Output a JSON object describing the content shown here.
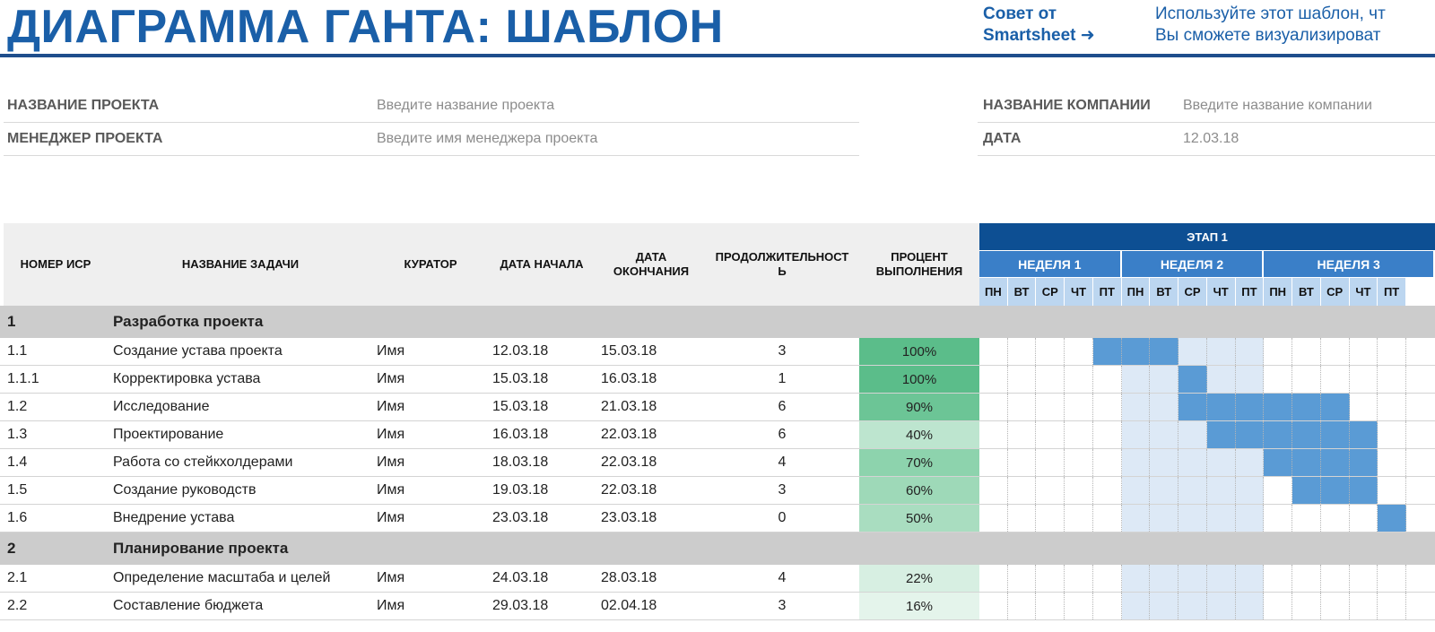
{
  "header": {
    "title": "ДИАГРАММА ГАНТА: ШАБЛОН",
    "tip_label_line1": "Совет от",
    "tip_label_line2": "Smartsheet ➜",
    "tip_text_line1": "Используйте этот шаблон, чт",
    "tip_text_line2": "Вы сможете визуализироват"
  },
  "meta": {
    "project_name_label": "НАЗВАНИЕ ПРОЕКТА",
    "project_name_placeholder": "Введите название проекта",
    "manager_label": "МЕНЕДЖЕР ПРОЕКТА",
    "manager_placeholder": "Введите имя менеджера проекта",
    "company_label": "НАЗВАНИЕ КОМПАНИИ",
    "company_placeholder": "Введите название компании",
    "date_label": "ДАТА",
    "date_value": "12.03.18"
  },
  "columns": {
    "wbs": "НОМЕР ИСР",
    "task": "НАЗВАНИЕ ЗАДАЧИ",
    "owner": "КУРАТОР",
    "start": "ДАТА НАЧАЛА",
    "end_line1": "ДАТА",
    "end_line2": "ОКОНЧАНИЯ",
    "duration_line1": "ПРОДОЛЖИТЕЛЬНОСТ",
    "duration_line2": "Ь",
    "pct_line1": "ПРОЦЕНТ",
    "pct_line2": "ВЫПОЛНЕНИЯ"
  },
  "gantt": {
    "phase": "ЭТАП 1",
    "weeks": [
      "НЕДЕЛЯ 1",
      "НЕДЕЛЯ 2",
      "НЕДЕЛЯ 3"
    ],
    "days": [
      "ПН",
      "ВТ",
      "СР",
      "ЧТ",
      "ПТ",
      "ПН",
      "ВТ",
      "СР",
      "ЧТ",
      "ПТ",
      "ПН",
      "ВТ",
      "СР",
      "ЧТ",
      "ПТ"
    ]
  },
  "rows": [
    {
      "type": "group",
      "wbs": "1",
      "task": "Разработка проекта"
    },
    {
      "type": "task",
      "wbs": "1.1",
      "task": "Создание устава проекта",
      "owner": "Имя",
      "start": "12.03.18",
      "end": "15.03.18",
      "duration": "3",
      "pct": "100%",
      "pct_value": 100,
      "bar": [
        4,
        6
      ]
    },
    {
      "type": "task",
      "wbs": "1.1.1",
      "task": "Корректировка устава",
      "owner": "Имя",
      "start": "15.03.18",
      "end": "16.03.18",
      "duration": "1",
      "pct": "100%",
      "pct_value": 100,
      "bar": [
        7,
        7
      ]
    },
    {
      "type": "task",
      "wbs": "1.2",
      "task": "Исследование",
      "owner": "Имя",
      "start": "15.03.18",
      "end": "21.03.18",
      "duration": "6",
      "pct": "90%",
      "pct_value": 90,
      "bar": [
        7,
        12
      ]
    },
    {
      "type": "task",
      "wbs": "1.3",
      "task": "Проектирование",
      "owner": "Имя",
      "start": "16.03.18",
      "end": "22.03.18",
      "duration": "6",
      "pct": "40%",
      "pct_value": 40,
      "bar": [
        8,
        13
      ]
    },
    {
      "type": "task",
      "wbs": "1.4",
      "task": "Работа со стейкхолдерами",
      "owner": "Имя",
      "start": "18.03.18",
      "end": "22.03.18",
      "duration": "4",
      "pct": "70%",
      "pct_value": 70,
      "bar": [
        10,
        13
      ]
    },
    {
      "type": "task",
      "wbs": "1.5",
      "task": "Создание руководств",
      "owner": "Имя",
      "start": "19.03.18",
      "end": "22.03.18",
      "duration": "3",
      "pct": "60%",
      "pct_value": 60,
      "bar": [
        11,
        13
      ]
    },
    {
      "type": "task",
      "wbs": "1.6",
      "task": "Внедрение устава",
      "owner": "Имя",
      "start": "23.03.18",
      "end": "23.03.18",
      "duration": "0",
      "pct": "50%",
      "pct_value": 50,
      "bar": [
        14,
        14
      ]
    },
    {
      "type": "group",
      "wbs": "2",
      "task": "Планирование проекта"
    },
    {
      "type": "task",
      "wbs": "2.1",
      "task": "Определение масштаба и целей",
      "owner": "Имя",
      "start": "24.03.18",
      "end": "28.03.18",
      "duration": "4",
      "pct": "22%",
      "pct_value": 22,
      "bar": null
    },
    {
      "type": "task",
      "wbs": "2.2",
      "task": "Составление бюджета",
      "owner": "Имя",
      "start": "29.03.18",
      "end": "02.04.18",
      "duration": "3",
      "pct": "16%",
      "pct_value": 16,
      "bar": null
    }
  ]
}
